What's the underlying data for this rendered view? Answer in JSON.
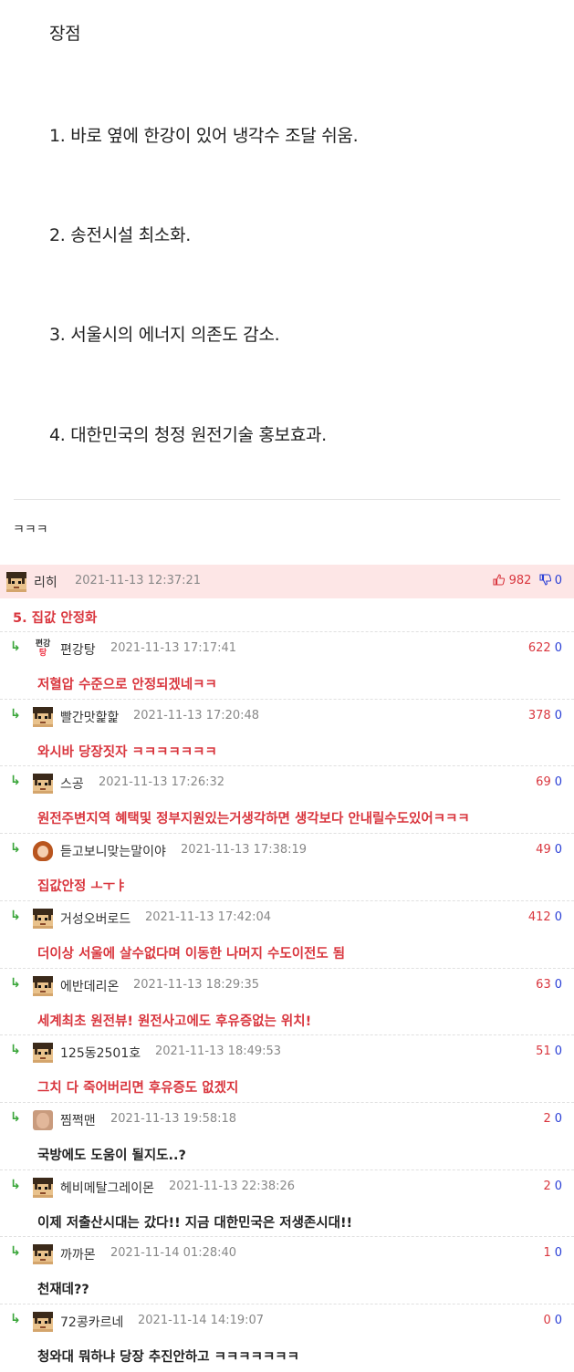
{
  "article": {
    "heading": "장점",
    "points": [
      "1. 바로 옆에 한강이 있어 냉각수 조달 쉬움.",
      "2. 송전시설 최소화.",
      "3. 서울시의 에너지 의존도 감소.",
      "4. 대한민국의 청정 원전기술 홍보효과."
    ],
    "closing": "ㅋㅋㅋ"
  },
  "best_comment": {
    "nick": "리히",
    "date": "2021-11-13 12:37:21",
    "up": "982",
    "down": "0",
    "content": "5. 집값 안정화"
  },
  "replies": [
    {
      "nick": "편강탕",
      "date": "2021-11-13 17:17:41",
      "up": "622",
      "down": "0",
      "content": "저혈압 수준으로 안정되겠네ㅋㅋ",
      "avatar": "text-avatar",
      "color": "red"
    },
    {
      "nick": "빨간맛핥핥",
      "date": "2021-11-13 17:20:48",
      "up": "378",
      "down": "0",
      "content": "와시바 당장짓자 ㅋㅋㅋㅋㅋㅋㅋ",
      "avatar": "pixel",
      "color": "red"
    },
    {
      "nick": "스공",
      "date": "2021-11-13 17:26:32",
      "up": "69",
      "down": "0",
      "content": "원전주변지역 혜택및 정부지원있는거생각하면 생각보다 안내릴수도있어ㅋㅋㅋ",
      "avatar": "pixel",
      "color": "red"
    },
    {
      "nick": "듣고보니맞는말이야",
      "date": "2021-11-13 17:38:19",
      "up": "49",
      "down": "0",
      "content": "집값안정 ㅗㅜㅑ",
      "avatar": "girl",
      "color": "red"
    },
    {
      "nick": "거성오버로드",
      "date": "2021-11-13 17:42:04",
      "up": "412",
      "down": "0",
      "content": "더이상 서울에 살수없다며 이동한 나머지 수도이전도 됨",
      "avatar": "pixel",
      "color": "red"
    },
    {
      "nick": "에반데리온",
      "date": "2021-11-13 18:29:35",
      "up": "63",
      "down": "0",
      "content": "세계최초 원전뷰! 원전사고에도 후유증없는 위치!",
      "avatar": "pixel",
      "color": "red"
    },
    {
      "nick": "125동2501호",
      "date": "2021-11-13 18:49:53",
      "up": "51",
      "down": "0",
      "content": "그치 다 죽어버리면 후유증도 없겠지",
      "avatar": "pixel",
      "color": "red"
    },
    {
      "nick": "찜쩍맨",
      "date": "2021-11-13 19:58:18",
      "up": "2",
      "down": "0",
      "content": "국방에도 도움이 될지도..?",
      "avatar": "man",
      "color": "dark"
    },
    {
      "nick": "헤비메탈그레이몬",
      "date": "2021-11-13 22:38:26",
      "up": "2",
      "down": "0",
      "content": "이제 저출산시대는 갔다!! 지금 대한민국은 저생존시대!!",
      "avatar": "pixel",
      "color": "dark"
    },
    {
      "nick": "까까몬",
      "date": "2021-11-14 01:28:40",
      "up": "1",
      "down": "0",
      "content": "천재데??",
      "avatar": "pixel",
      "color": "dark"
    },
    {
      "nick": "72콩카르네",
      "date": "2021-11-14 14:19:07",
      "up": "0",
      "down": "0",
      "content": "청와대 뭐하냐 당장 추진안하고 ㅋㅋㅋㅋㅋㅋㅋ",
      "avatar": "pixel",
      "color": "dark"
    }
  ],
  "text_avatar": {
    "line1": "편강",
    "line2": "탕"
  },
  "reply_arrow": "↳"
}
